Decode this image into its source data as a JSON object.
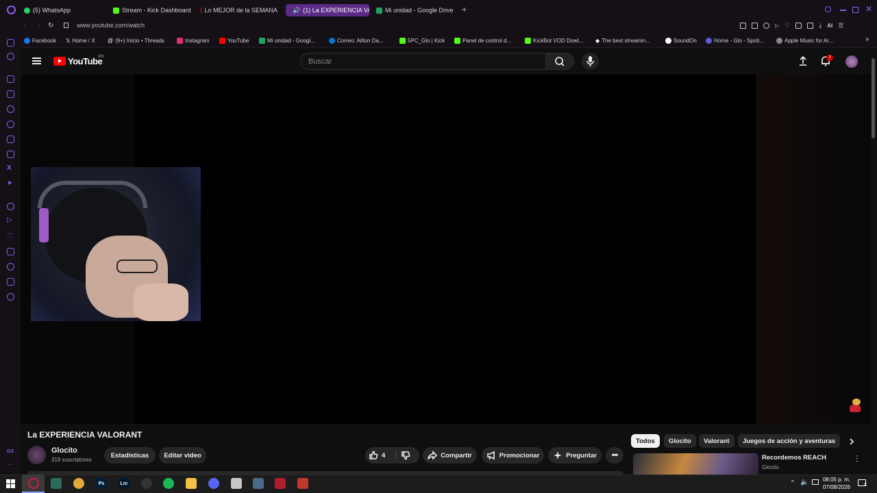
{
  "browser": {
    "tabs": [
      {
        "label": "(5) WhatsApp",
        "color": "#25d366"
      },
      {
        "label": "Stream - Kick Dashboard",
        "color": "#53fc18"
      },
      {
        "label": "Lo MEJOR de la SEMANA",
        "color": "#ff0000"
      },
      {
        "label": "(1) La EXPERIENCIA VA",
        "color": "#ff0000",
        "active": true
      },
      {
        "label": "Mi unidad - Google Drive",
        "color": "#1fa463"
      }
    ],
    "url": "www.youtube.com/watch",
    "bookmarks": [
      {
        "label": "Facebook",
        "color": "#1877f2"
      },
      {
        "label": "Home / X",
        "color": "#ffffff"
      },
      {
        "label": "(9+) Inicio • Threads",
        "color": "#ffffff"
      },
      {
        "label": "Instagram",
        "color": "#e1306c"
      },
      {
        "label": "YouTube",
        "color": "#ff0000"
      },
      {
        "label": "Mi unidad - Googl...",
        "color": "#1fa463"
      },
      {
        "label": "Correo: Ailton Da...",
        "color": "#0078d4"
      },
      {
        "label": "5PC_Glo | Kick",
        "color": "#53fc18"
      },
      {
        "label": "Panel de control d...",
        "color": "#53fc18"
      },
      {
        "label": "KickBot VOD Dowl...",
        "color": "#53fc18"
      },
      {
        "label": "The best streamin...",
        "color": "#ffffff"
      },
      {
        "label": "SoundOn",
        "color": "#ffffff"
      },
      {
        "label": "Home - Glo - Spoti...",
        "color": "#5b5bd6"
      },
      {
        "label": "Apple Music for Ar...",
        "color": "#888888"
      }
    ],
    "accent": "#8e5cf2"
  },
  "youtube": {
    "logo_text": "YouTube",
    "region": "MX",
    "search_placeholder": "Buscar",
    "notifications_count": "1",
    "video": {
      "title": "La EXPERIENCIA VALORANT",
      "channel_name": "Glocito",
      "subscribers": "319 suscriptores",
      "likes": "4",
      "buttons": {
        "stats": "Estadísticas",
        "edit": "Editar video",
        "share": "Compartir",
        "promote": "Promocionar",
        "ask": "Preguntar"
      }
    },
    "chips": [
      "Todos",
      "Glocito",
      "Valorant",
      "Juegos de acción y aventuras"
    ],
    "recommended": {
      "title": "Recordemos REACH",
      "channel": "Glocito"
    }
  },
  "taskbar": {
    "time": "08:05 p. m.",
    "date": "07/08/2026",
    "notification_count": "2",
    "apps": [
      {
        "name": "opera-app",
        "label": "",
        "color": "#d01c3e"
      },
      {
        "name": "image-app",
        "label": "",
        "color": "#2b6b5e"
      },
      {
        "name": "chrome-app",
        "label": "",
        "color": "#e2a83a"
      },
      {
        "name": "photoshop-app",
        "label": "Ps",
        "color": "#001e36"
      },
      {
        "name": "lightroom-app",
        "label": "Lrc",
        "color": "#001a2e"
      },
      {
        "name": "obs-app",
        "label": "",
        "color": "#333333"
      },
      {
        "name": "spotify-app",
        "label": "",
        "color": "#1db954"
      },
      {
        "name": "explorer-app",
        "label": "",
        "color": "#f3c146"
      },
      {
        "name": "discord-app",
        "label": "",
        "color": "#5865f2"
      },
      {
        "name": "whatsapp-app",
        "label": "",
        "color": "#c8c8c8"
      },
      {
        "name": "calculator-app",
        "label": "",
        "color": "#4a6a8a"
      },
      {
        "name": "voicemeeter-app",
        "label": "",
        "color": "#b01e2e"
      },
      {
        "name": "game-app",
        "label": "",
        "color": "#c0392b"
      }
    ]
  }
}
